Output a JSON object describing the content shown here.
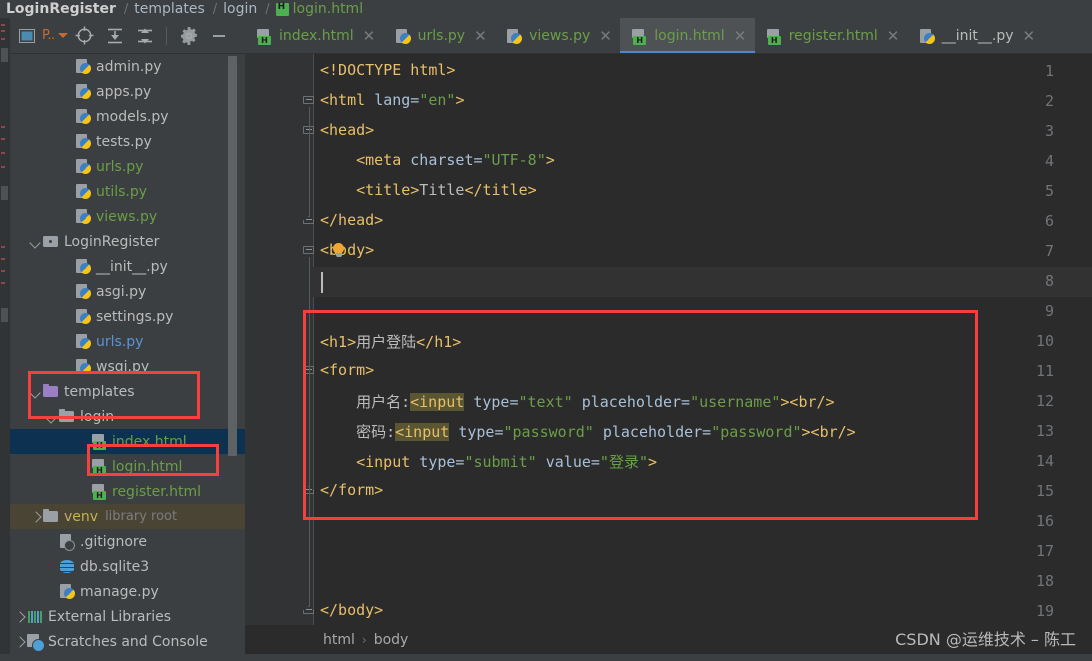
{
  "top_breadcrumb": {
    "project": "LoginRegister",
    "folder1": "templates",
    "folder2": "login",
    "file": "login.html",
    "sep": "/"
  },
  "toolbar": {
    "project_label": "P..",
    "icons": [
      "project-selector",
      "locate-file-icon",
      "expand-all-icon",
      "collapse-all-icon",
      "settings-gear-icon",
      "hide-panel-icon"
    ]
  },
  "tree": {
    "items": [
      {
        "label": "admin.py",
        "indent": 3,
        "icon": "python-file-icon",
        "color": "gray",
        "arrow": "none"
      },
      {
        "label": "apps.py",
        "indent": 3,
        "icon": "python-file-icon",
        "color": "gray",
        "arrow": "none"
      },
      {
        "label": "models.py",
        "indent": 3,
        "icon": "python-file-icon",
        "color": "gray",
        "arrow": "none"
      },
      {
        "label": "tests.py",
        "indent": 3,
        "icon": "python-file-icon",
        "color": "gray",
        "arrow": "none"
      },
      {
        "label": "urls.py",
        "indent": 3,
        "icon": "python-file-icon",
        "color": "green",
        "arrow": "none"
      },
      {
        "label": "utils.py",
        "indent": 3,
        "icon": "python-file-icon",
        "color": "green",
        "arrow": "none"
      },
      {
        "label": "views.py",
        "indent": 3,
        "icon": "python-file-icon",
        "color": "green",
        "arrow": "none"
      },
      {
        "label": "LoginRegister",
        "indent": 1,
        "icon": "folder-module-icon",
        "color": "gray",
        "arrow": "down"
      },
      {
        "label": "__init__.py",
        "indent": 3,
        "icon": "python-file-icon",
        "color": "gray",
        "arrow": "none"
      },
      {
        "label": "asgi.py",
        "indent": 3,
        "icon": "python-file-icon",
        "color": "gray",
        "arrow": "none"
      },
      {
        "label": "settings.py",
        "indent": 3,
        "icon": "python-file-icon",
        "color": "gray",
        "arrow": "none"
      },
      {
        "label": "urls.py",
        "indent": 3,
        "icon": "python-file-icon",
        "color": "blue",
        "arrow": "none"
      },
      {
        "label": "wsgi.py",
        "indent": 3,
        "icon": "python-file-icon",
        "color": "gray",
        "arrow": "none"
      },
      {
        "label": "templates",
        "indent": 1,
        "icon": "folder-purple-icon",
        "color": "gray",
        "arrow": "down"
      },
      {
        "label": "login",
        "indent": 2,
        "icon": "folder-icon",
        "color": "gray",
        "arrow": "down"
      },
      {
        "label": "index.html",
        "indent": 4,
        "icon": "html-file-icon",
        "color": "green",
        "arrow": "none",
        "selected": true
      },
      {
        "label": "login.html",
        "indent": 4,
        "icon": "html-file-icon",
        "color": "green",
        "arrow": "none"
      },
      {
        "label": "register.html",
        "indent": 4,
        "icon": "html-file-icon",
        "color": "green",
        "arrow": "none"
      },
      {
        "label": "venv",
        "badge": "library root",
        "indent": 1,
        "icon": "folder-icon",
        "color": "yellow",
        "arrow": "right",
        "venv": true
      },
      {
        "label": ".gitignore",
        "indent": 2,
        "icon": "gitignore-icon",
        "color": "gray",
        "arrow": "none"
      },
      {
        "label": "db.sqlite3",
        "indent": 2,
        "icon": "database-icon",
        "color": "gray",
        "arrow": "none"
      },
      {
        "label": "manage.py",
        "indent": 2,
        "icon": "python-file-icon",
        "color": "gray",
        "arrow": "none"
      },
      {
        "label": "External Libraries",
        "indent": 0,
        "icon": "libraries-icon",
        "color": "gray",
        "arrow": "right"
      },
      {
        "label": "Scratches and Console",
        "indent": 0,
        "icon": "scratches-icon",
        "color": "gray",
        "arrow": "right"
      }
    ]
  },
  "tabs": [
    {
      "label": "index.html",
      "icon": "html-file-icon",
      "color": "green",
      "active": false
    },
    {
      "label": "urls.py",
      "icon": "python-file-icon",
      "color": "green",
      "active": false
    },
    {
      "label": "views.py",
      "icon": "python-file-icon",
      "color": "green",
      "active": false
    },
    {
      "label": "login.html",
      "icon": "html-file-icon",
      "color": "green",
      "active": true
    },
    {
      "label": "register.html",
      "icon": "html-file-icon",
      "color": "green",
      "active": false
    },
    {
      "label": "__init__.py",
      "icon": "python-file-icon",
      "color": "gray",
      "active": false
    }
  ],
  "close_glyph": "✕",
  "code": {
    "lines": [
      {
        "n": 1,
        "indent": 0,
        "fold": "none",
        "segments": [
          {
            "t": "<!DOCTYPE html>",
            "c": "tk-doctype"
          }
        ]
      },
      {
        "n": 2,
        "indent": 0,
        "fold": "open",
        "segments": [
          {
            "t": "<html ",
            "c": "tk-tag"
          },
          {
            "t": "lang=",
            "c": "tk-attr"
          },
          {
            "t": "\"en\"",
            "c": "tk-val"
          },
          {
            "t": ">",
            "c": "tk-tag"
          }
        ]
      },
      {
        "n": 3,
        "indent": 0,
        "fold": "open",
        "segments": [
          {
            "t": "<head>",
            "c": "tk-tag"
          }
        ]
      },
      {
        "n": 4,
        "indent": 4,
        "fold": "none",
        "segments": [
          {
            "t": "<meta ",
            "c": "tk-tag"
          },
          {
            "t": "charset=",
            "c": "tk-attr"
          },
          {
            "t": "\"UTF-8\"",
            "c": "tk-val"
          },
          {
            "t": ">",
            "c": "tk-tag"
          }
        ]
      },
      {
        "n": 5,
        "indent": 4,
        "fold": "none",
        "segments": [
          {
            "t": "<title>",
            "c": "tk-tag"
          },
          {
            "t": "Title",
            "c": "tk-txt"
          },
          {
            "t": "</title>",
            "c": "tk-tag"
          }
        ]
      },
      {
        "n": 6,
        "indent": 0,
        "fold": "close",
        "segments": [
          {
            "t": "</head>",
            "c": "tk-tag"
          }
        ]
      },
      {
        "n": 7,
        "indent": 0,
        "fold": "open",
        "segments": [
          {
            "t": "<body>",
            "c": "tk-tag"
          }
        ],
        "bulb": true
      },
      {
        "n": 8,
        "indent": 0,
        "fold": "none",
        "segments": [],
        "current": true,
        "caret": true
      },
      {
        "n": 9,
        "indent": 0,
        "fold": "none",
        "segments": []
      },
      {
        "n": 10,
        "indent": 0,
        "fold": "none",
        "segments": [
          {
            "t": "<h1>",
            "c": "tk-tag"
          },
          {
            "t": "用户登陆",
            "c": "tk-txt"
          },
          {
            "t": "</h1>",
            "c": "tk-tag"
          }
        ]
      },
      {
        "n": 11,
        "indent": 0,
        "fold": "open",
        "segments": [
          {
            "t": "<form>",
            "c": "tk-tag"
          }
        ]
      },
      {
        "n": 12,
        "indent": 4,
        "fold": "none",
        "segments": [
          {
            "t": "用户名:",
            "c": "tk-txt"
          },
          {
            "t": "<input",
            "c": "hl-input"
          },
          {
            "t": " ",
            "c": "tk-tag"
          },
          {
            "t": "type=",
            "c": "tk-attr"
          },
          {
            "t": "\"text\"",
            "c": "tk-val"
          },
          {
            "t": " ",
            "c": "tk-attr"
          },
          {
            "t": "placeholder=",
            "c": "tk-attr"
          },
          {
            "t": "\"username\"",
            "c": "tk-val"
          },
          {
            "t": "><br/>",
            "c": "tk-tag"
          }
        ]
      },
      {
        "n": 13,
        "indent": 4,
        "fold": "none",
        "segments": [
          {
            "t": "密码:",
            "c": "tk-txt"
          },
          {
            "t": "<input",
            "c": "hl-input"
          },
          {
            "t": " ",
            "c": "tk-tag"
          },
          {
            "t": "type=",
            "c": "tk-attr"
          },
          {
            "t": "\"password\"",
            "c": "tk-val"
          },
          {
            "t": " ",
            "c": "tk-attr"
          },
          {
            "t": "placeholder=",
            "c": "tk-attr"
          },
          {
            "t": "\"password\"",
            "c": "tk-val"
          },
          {
            "t": "><br/>",
            "c": "tk-tag"
          }
        ]
      },
      {
        "n": 14,
        "indent": 4,
        "fold": "none",
        "segments": [
          {
            "t": "<input ",
            "c": "tk-tag"
          },
          {
            "t": "type=",
            "c": "tk-attr"
          },
          {
            "t": "\"submit\"",
            "c": "tk-val"
          },
          {
            "t": " ",
            "c": "tk-attr"
          },
          {
            "t": "value=",
            "c": "tk-attr"
          },
          {
            "t": "\"登录\"",
            "c": "tk-val"
          },
          {
            "t": ">",
            "c": "tk-tag"
          }
        ]
      },
      {
        "n": 15,
        "indent": 0,
        "fold": "close",
        "segments": [
          {
            "t": "</form>",
            "c": "tk-tag"
          }
        ]
      },
      {
        "n": 16,
        "indent": 0,
        "fold": "none",
        "segments": []
      },
      {
        "n": 17,
        "indent": 0,
        "fold": "none",
        "segments": []
      },
      {
        "n": 18,
        "indent": 0,
        "fold": "none",
        "segments": []
      },
      {
        "n": 19,
        "indent": 0,
        "fold": "close",
        "segments": [
          {
            "t": "</body>",
            "c": "tk-tag"
          }
        ]
      }
    ]
  },
  "bottom_breadcrumb": {
    "items": [
      "html",
      "body"
    ],
    "sep": "›"
  },
  "watermark": "CSDN @运维技术 – 陈工",
  "colors": {
    "accent_tab": "#4d86d1",
    "highlight_box": "#f5403f",
    "selection": "#0d3251",
    "editor_bg": "#2b2b2b",
    "panel_bg": "#3c3f41"
  }
}
